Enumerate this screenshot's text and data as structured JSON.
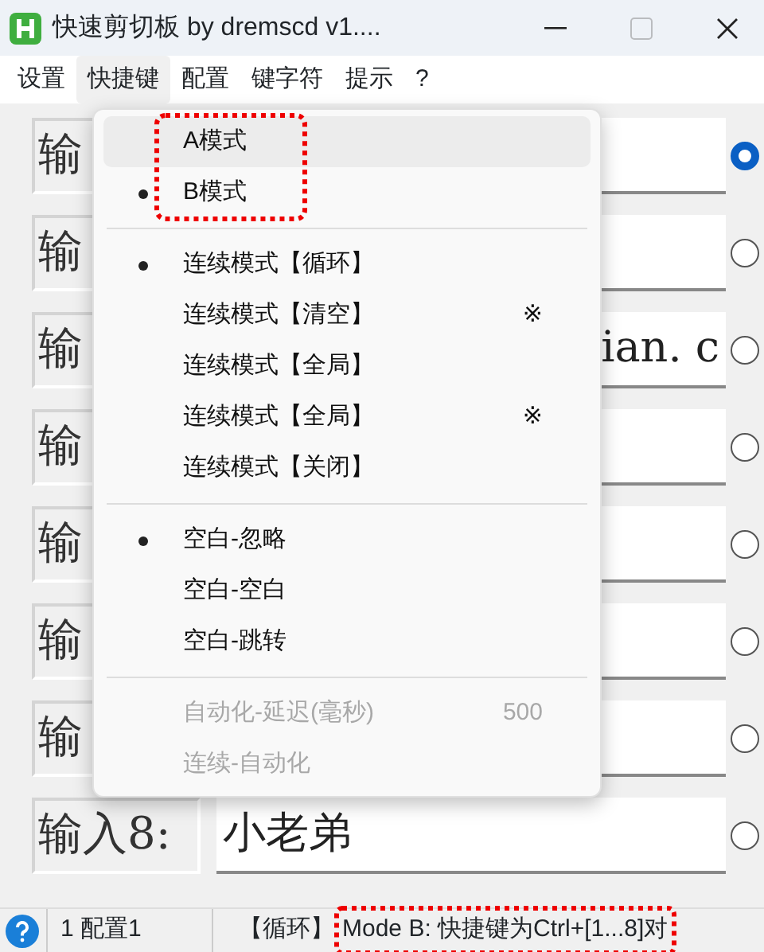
{
  "window": {
    "title": "快速剪切板 by dremscd v1...."
  },
  "menubar": [
    {
      "label": "设置",
      "selected": false
    },
    {
      "label": "快捷键",
      "selected": true
    },
    {
      "label": "配置",
      "selected": false
    },
    {
      "label": "键字符",
      "selected": false
    },
    {
      "label": "提示",
      "selected": false
    },
    {
      "label": "?",
      "selected": false
    }
  ],
  "rows": [
    {
      "label": "输",
      "selected": true
    },
    {
      "label": "输",
      "selected": false
    },
    {
      "label": "输",
      "value": "ian. c",
      "scrolled_to_end": true,
      "selected": false
    },
    {
      "label": "输",
      "selected": false
    },
    {
      "label": "输",
      "selected": false
    },
    {
      "label": "输",
      "selected": false
    },
    {
      "label": "输",
      "selected": false
    },
    {
      "label": "输入8:",
      "value": "小老弟",
      "scrolled_to_end": false,
      "selected": false
    }
  ],
  "menu": [
    {
      "kind": "item",
      "label": "A模式",
      "checked": false,
      "hovered": true,
      "disabled": false,
      "annotated": true
    },
    {
      "kind": "item",
      "label": "B模式",
      "checked": true,
      "hovered": false,
      "disabled": false,
      "annotated": true
    },
    {
      "kind": "separator"
    },
    {
      "kind": "item",
      "label": "连续模式【循环】",
      "checked": true,
      "hovered": false,
      "disabled": false,
      "annotated": false
    },
    {
      "kind": "item",
      "label": "连续模式【清空】",
      "shortcut": "※",
      "checked": false,
      "hovered": false,
      "disabled": false,
      "annotated": false
    },
    {
      "kind": "item",
      "label": "连续模式【全局】",
      "checked": false,
      "hovered": false,
      "disabled": false,
      "annotated": false
    },
    {
      "kind": "item",
      "label": "连续模式【全局】",
      "shortcut": "※",
      "checked": false,
      "hovered": false,
      "disabled": false,
      "annotated": false
    },
    {
      "kind": "item",
      "label": "连续模式【关闭】",
      "checked": false,
      "hovered": false,
      "disabled": false,
      "annotated": false
    },
    {
      "kind": "separator"
    },
    {
      "kind": "item",
      "label": "空白-忽略",
      "checked": true,
      "hovered": false,
      "disabled": false,
      "annotated": false
    },
    {
      "kind": "item",
      "label": "空白-空白",
      "checked": false,
      "hovered": false,
      "disabled": false,
      "annotated": false
    },
    {
      "kind": "item",
      "label": "空白-跳转",
      "checked": false,
      "hovered": false,
      "disabled": false,
      "annotated": false
    },
    {
      "kind": "separator"
    },
    {
      "kind": "item",
      "label": "自动化-延迟(毫秒)",
      "shortcut": "500",
      "checked": false,
      "hovered": false,
      "disabled": true,
      "annotated": false
    },
    {
      "kind": "item",
      "label": "连续-自动化",
      "checked": false,
      "hovered": false,
      "disabled": true,
      "annotated": false
    }
  ],
  "status_bar": {
    "config": "1 配置1",
    "mode": "【循环】",
    "hint": "Mode B: 快捷键为Ctrl+[1...8]对",
    "hint_annotated": true
  }
}
